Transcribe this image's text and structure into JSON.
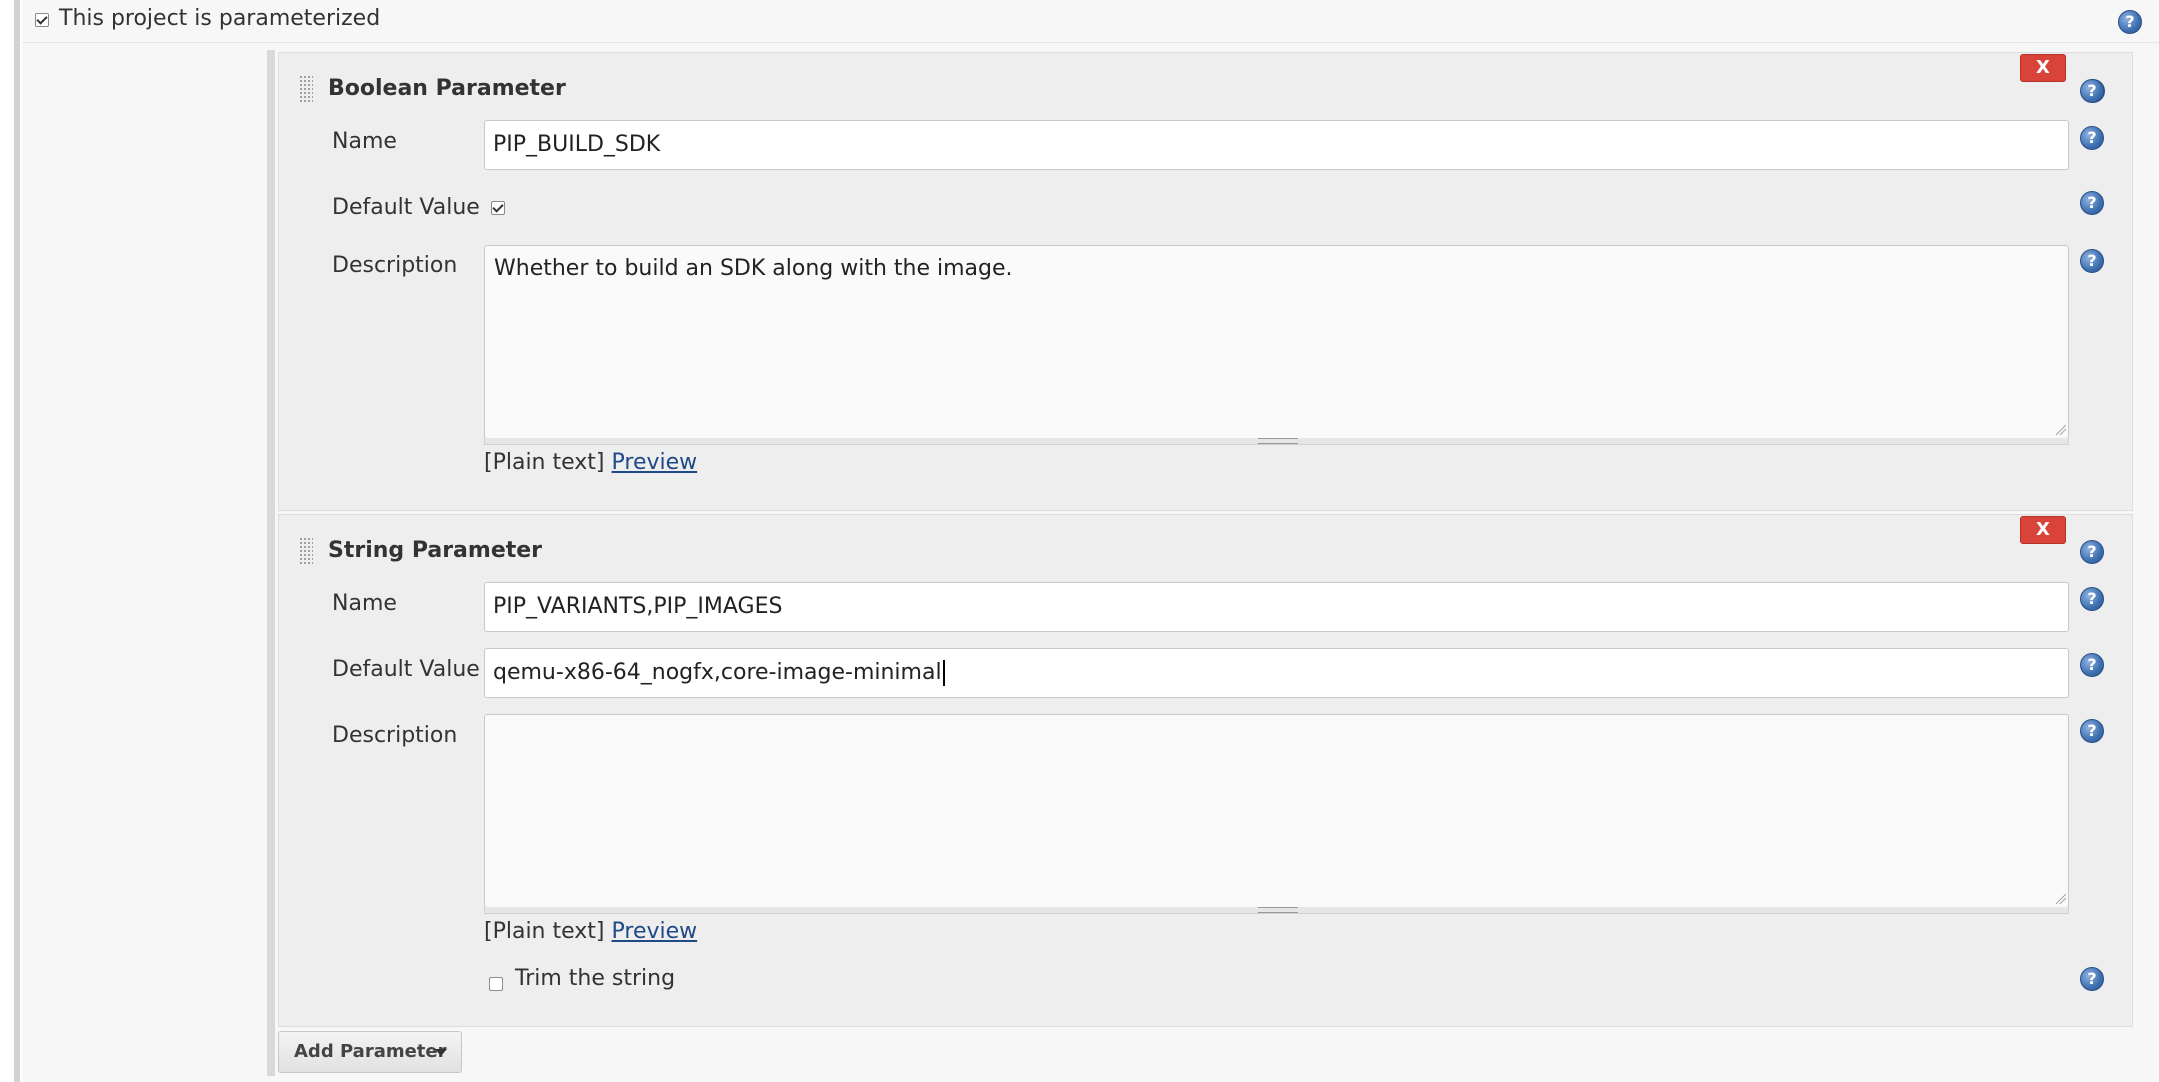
{
  "header": {
    "parameterized_label": "This project is parameterized",
    "parameterized_checked": true
  },
  "parameters": [
    {
      "title": "Boolean Parameter",
      "delete_label": "X",
      "name_label": "Name",
      "name_value": "PIP_BUILD_SDK",
      "default_label": "Default Value",
      "default_checked": true,
      "description_label": "Description",
      "description_value": "Whether to build an SDK along with the image.",
      "markup_label": "[Plain text]",
      "preview_label": "Preview"
    },
    {
      "title": "String Parameter",
      "delete_label": "X",
      "name_label": "Name",
      "name_value": "PIP_VARIANTS,PIP_IMAGES",
      "default_label": "Default Value",
      "default_value": "qemu-x86-64_nogfx,core-image-minimal",
      "description_label": "Description",
      "description_value": "",
      "markup_label": "[Plain text]",
      "preview_label": "Preview",
      "trim_label": "Trim the string",
      "trim_checked": false
    }
  ],
  "add_parameter_label": "Add Parameter",
  "help_icon_glyph": "?",
  "colors": {
    "delete_button": "#d9433a",
    "help_icon": "#3c6fb0",
    "link": "#204a87"
  }
}
